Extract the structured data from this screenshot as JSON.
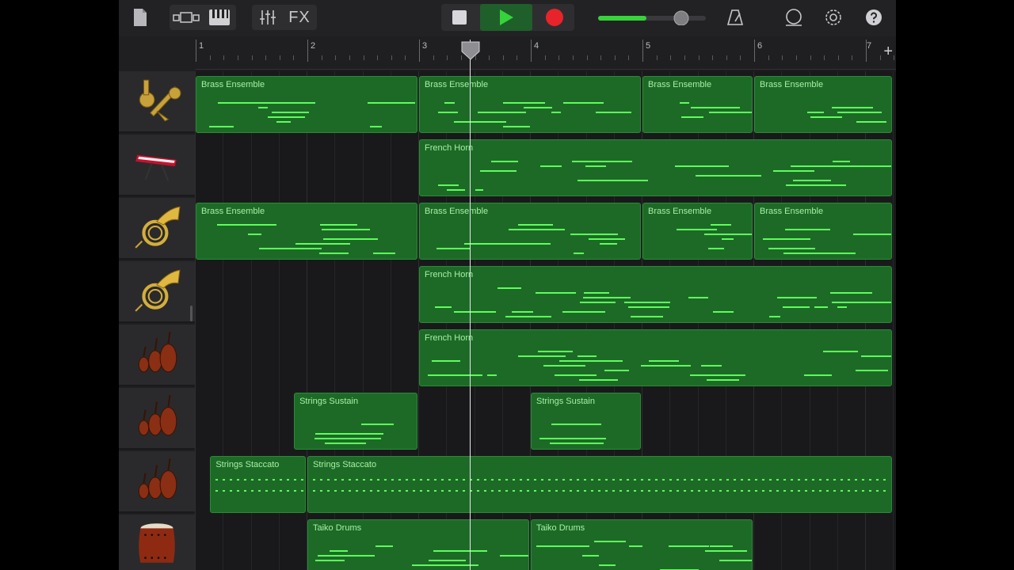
{
  "toolbar": {
    "fx_label": "FX",
    "volume_level": 0.72
  },
  "ruler": {
    "bars": [
      "1",
      "2",
      "3",
      "4",
      "5",
      "6",
      "7"
    ]
  },
  "tracks": [
    {
      "instrument": "brass-ensemble",
      "regions": [
        {
          "name": "Brass Ensemble"
        },
        {
          "name": "Brass Ensemble"
        },
        {
          "name": "Brass Ensemble"
        },
        {
          "name": "Brass Ensemble"
        }
      ]
    },
    {
      "instrument": "keyboard",
      "regions": [
        {
          "name": "French Horn"
        }
      ]
    },
    {
      "instrument": "french-horn",
      "regions": [
        {
          "name": "Brass Ensemble"
        },
        {
          "name": "Brass Ensemble"
        },
        {
          "name": "Brass Ensemble"
        },
        {
          "name": "Brass Ensemble"
        }
      ]
    },
    {
      "instrument": "french-horn",
      "regions": [
        {
          "name": "French Horn"
        }
      ]
    },
    {
      "instrument": "strings",
      "regions": [
        {
          "name": "French Horn"
        }
      ]
    },
    {
      "instrument": "strings",
      "regions": [
        {
          "name": "Strings Sustain"
        },
        {
          "name": "Strings Sustain"
        }
      ]
    },
    {
      "instrument": "strings",
      "regions": [
        {
          "name": "Strings Staccato"
        },
        {
          "name": "Strings Staccato"
        }
      ]
    },
    {
      "instrument": "taiko-drum",
      "regions": [
        {
          "name": "Taiko Drums"
        },
        {
          "name": "Taiko Drums"
        }
      ]
    }
  ],
  "colors": {
    "region_fill": "#1d6a27",
    "note": "#5dff5a",
    "record": "#e8232a",
    "play": "#37d33a"
  }
}
